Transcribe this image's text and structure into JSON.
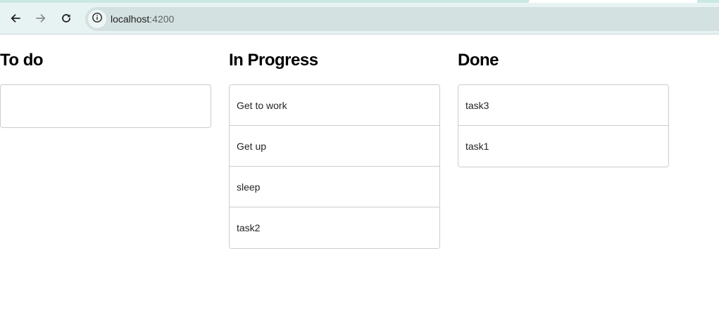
{
  "browser": {
    "url_host": "localhost",
    "url_port": ":4200",
    "icons": {
      "back": "arrow-left-icon",
      "forward": "arrow-right-icon",
      "reload": "reload-icon",
      "site_info": "info-icon"
    }
  },
  "board": {
    "columns": [
      {
        "title": "To do",
        "tasks": []
      },
      {
        "title": "In Progress",
        "tasks": [
          "Get to work",
          "Get up",
          "sleep",
          "task2"
        ]
      },
      {
        "title": "Done",
        "tasks": [
          "task3",
          "task1"
        ]
      }
    ]
  },
  "colors": {
    "toolbar_bg": "#e7f3f2",
    "omnibox_bg": "#d3e1e0",
    "list_border": "#cccccc"
  }
}
